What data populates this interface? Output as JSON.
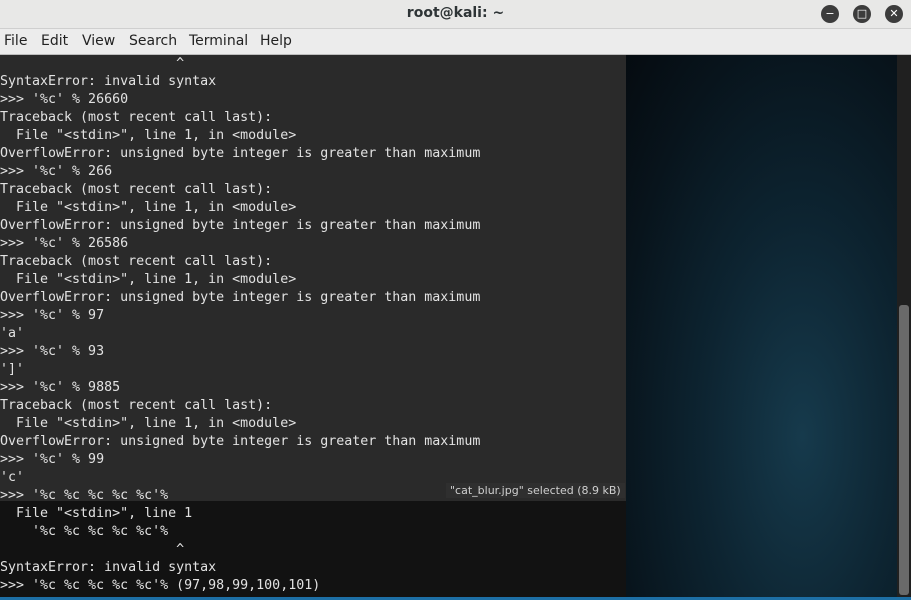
{
  "window": {
    "title": "root@kali: ~",
    "controls": {
      "minimize": "−",
      "maximize": "□",
      "close": "✕"
    }
  },
  "menu": [
    "File",
    "Edit",
    "View",
    "Search",
    "Terminal",
    "Help"
  ],
  "terminal_lines": [
    "                      ^",
    "SyntaxError: invalid syntax",
    ">>> '%c' % 26660",
    "Traceback (most recent call last):",
    "  File \"<stdin>\", line 1, in <module>",
    "OverflowError: unsigned byte integer is greater than maximum",
    ">>> '%c' % 266",
    "Traceback (most recent call last):",
    "  File \"<stdin>\", line 1, in <module>",
    "OverflowError: unsigned byte integer is greater than maximum",
    ">>> '%c' % 26586",
    "Traceback (most recent call last):",
    "  File \"<stdin>\", line 1, in <module>",
    "OverflowError: unsigned byte integer is greater than maximum",
    ">>> '%c' % 97",
    "'a'",
    ">>> '%c' % 93",
    "']'",
    ">>> '%c' % 9885",
    "Traceback (most recent call last):",
    "  File \"<stdin>\", line 1, in <module>",
    "OverflowError: unsigned byte integer is greater than maximum",
    ">>> '%c' % 99",
    "'c'",
    ">>> '%c %c %c %c %c'%",
    "  File \"<stdin>\", line 1",
    "    '%c %c %c %c %c'%",
    "                      ^",
    "SyntaxError: invalid syntax",
    ">>> '%c %c %c %c %c'% (97,98,99,100,101)"
  ],
  "overlay_tooltip": "\"cat_blur.jpg\" selected  (8.9 kB)"
}
